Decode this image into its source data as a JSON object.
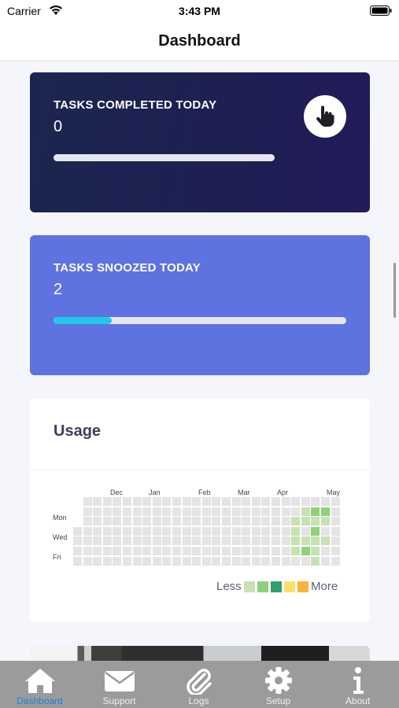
{
  "status_bar": {
    "carrier": "Carrier",
    "time": "3:43 PM"
  },
  "nav": {
    "title": "Dashboard"
  },
  "completed_card": {
    "label": "TASKS COMPLETED TODAY",
    "value": "0",
    "progress": 0,
    "icon": "hand-pointer-icon"
  },
  "snoozed_card": {
    "label": "TASKS SNOOZED TODAY",
    "value": "2",
    "progress": 0.2
  },
  "usage": {
    "title": "Usage",
    "months": [
      "Dec",
      "Jan",
      "Feb",
      "Mar",
      "Apr",
      "May"
    ],
    "days": [
      "Mon",
      "Wed",
      "Fri"
    ],
    "legend_less": "Less",
    "legend_more": "More",
    "legend_colors": [
      "#c6e2b0",
      "#8fd07b",
      "#2fa16a",
      "#fbe06c",
      "#f7b33c"
    ],
    "empty_color": "#e4e4e4",
    "week_count": 27,
    "activity": [
      {
        "week": 23,
        "day": 1,
        "level": 1
      },
      {
        "week": 24,
        "day": 1,
        "level": 2
      },
      {
        "week": 25,
        "day": 1,
        "level": 2
      },
      {
        "week": 22,
        "day": 2,
        "level": 1
      },
      {
        "week": 23,
        "day": 2,
        "level": 1
      },
      {
        "week": 24,
        "day": 2,
        "level": 1
      },
      {
        "week": 25,
        "day": 2,
        "level": 1
      },
      {
        "week": 22,
        "day": 3,
        "level": 1
      },
      {
        "week": 24,
        "day": 3,
        "level": 2
      },
      {
        "week": 22,
        "day": 4,
        "level": 1
      },
      {
        "week": 23,
        "day": 4,
        "level": 1
      },
      {
        "week": 24,
        "day": 4,
        "level": 1
      },
      {
        "week": 25,
        "day": 4,
        "level": 1
      },
      {
        "week": 22,
        "day": 5,
        "level": 1
      },
      {
        "week": 23,
        "day": 5,
        "level": 2
      },
      {
        "week": 24,
        "day": 5,
        "level": 1
      },
      {
        "week": 24,
        "day": 6,
        "level": 1
      }
    ]
  },
  "tabs": [
    {
      "label": "Dashboard",
      "icon": "home-icon",
      "active": true
    },
    {
      "label": "Support",
      "icon": "envelope-icon",
      "active": false
    },
    {
      "label": "Logs",
      "icon": "paperclip-icon",
      "active": false
    },
    {
      "label": "Setup",
      "icon": "gear-icon",
      "active": false
    },
    {
      "label": "About",
      "icon": "info-icon",
      "active": false
    }
  ]
}
